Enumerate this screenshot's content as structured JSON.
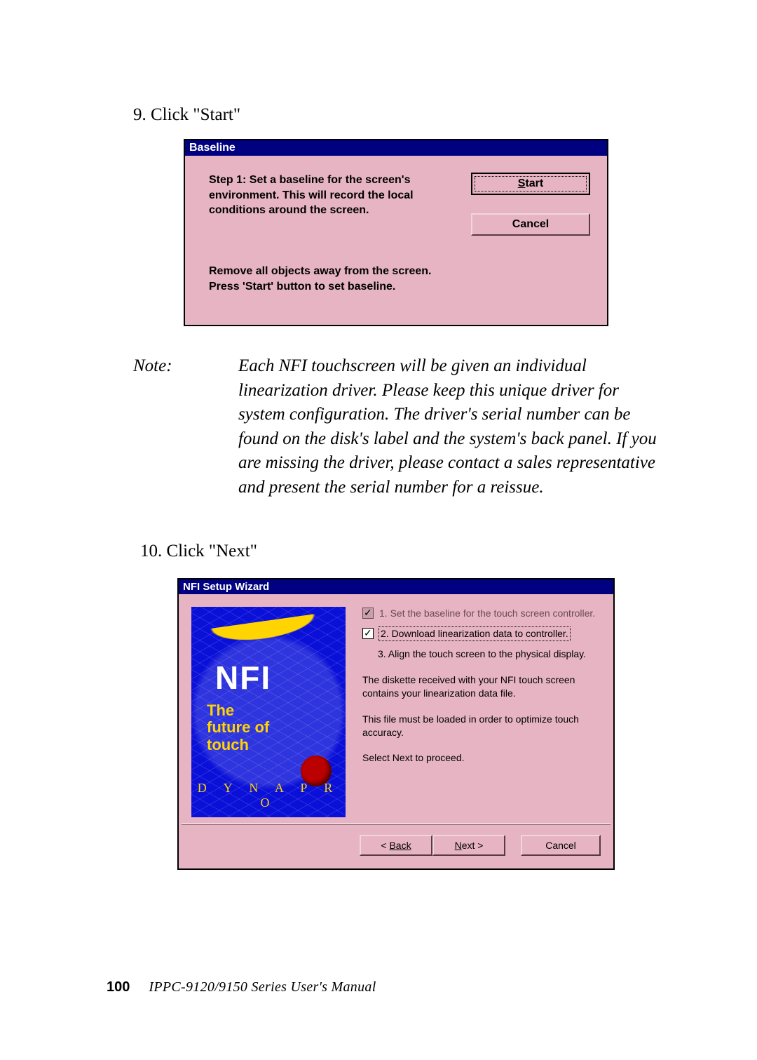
{
  "step9": "9. Click \"Start\"",
  "baseline": {
    "title": "Baseline",
    "step_text": "Step 1:  Set a baseline for the screen's environment.  This will record the local conditions around the screen.",
    "start_btn": "Start",
    "cancel_btn": "Cancel",
    "note_line1": "Remove all objects away from the screen.",
    "note_line2": "Press 'Start' button to set baseline."
  },
  "note": {
    "label": "Note:",
    "text": "Each NFI touchscreen will be given an individual linearization driver. Please keep this unique driver for system configuration. The driver's serial number can be found on the disk's label and the system's back panel. If you are missing the driver, please contact a sales representative and present the serial number for a reissue."
  },
  "step10": "10. Click \"Next\"",
  "wizard": {
    "title": "NFI Setup Wizard",
    "logo_main": "NFI",
    "logo_sub1": "The",
    "logo_sub2": "future of",
    "logo_sub3": "touch",
    "logo_brand": "D Y N A P R O",
    "steps": [
      {
        "checked": true,
        "text": "1.  Set the baseline for the touch screen controller.",
        "grayed": true
      },
      {
        "checked": true,
        "text": "2.  Download linearization data to controller.",
        "focused": true
      },
      {
        "checked": false,
        "text": "3.  Align the touch screen to the physical display."
      }
    ],
    "p1": "The diskette received with your NFI touch screen contains your linearization data file.",
    "p2": "This file must be loaded in order to optimize touch accuracy.",
    "p3": "Select Next to proceed.",
    "back_btn": "Back",
    "next_btn": "Next >",
    "cancel_btn": "Cancel"
  },
  "footer": {
    "page_number": "100",
    "manual": "IPPC-9120/9150 Series   User's Manual"
  }
}
